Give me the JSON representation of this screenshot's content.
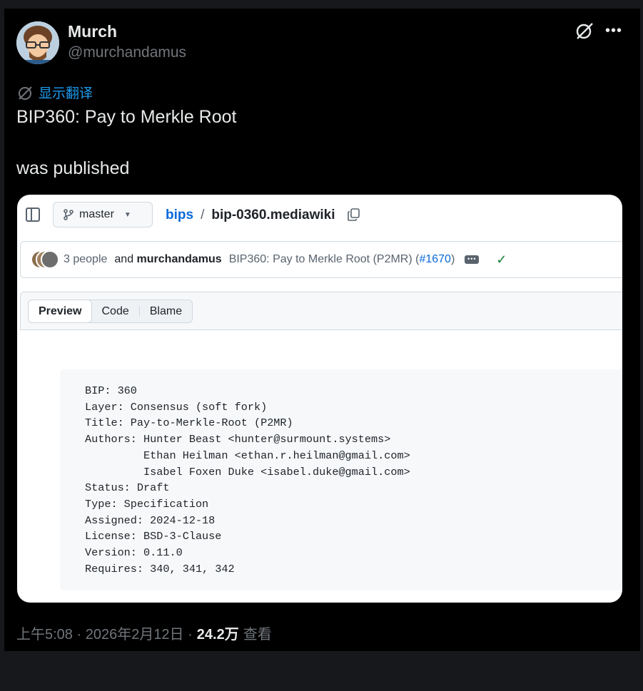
{
  "author": {
    "name": "Murch",
    "handle": "@murchandamus"
  },
  "translate_label": "显示翻译",
  "tweet": {
    "line1": "BIP360: Pay to Merkle Root",
    "line2": "was published"
  },
  "icons": {
    "grok": "grok-icon",
    "more": "more-icon",
    "translate": "translate-icon"
  },
  "github": {
    "branch": "master",
    "path_repo": "bips",
    "path_sep": "/",
    "path_file": "bip-0360.mediawiki",
    "commit": {
      "people": "3 people",
      "and": "and",
      "author": "murchandamus",
      "message": "BIP360: Pay to Merkle Root (P2MR) (",
      "pr": "#1670",
      "message_end": ")"
    },
    "tabs": [
      "Preview",
      "Code",
      "Blame"
    ],
    "code_lines": [
      "BIP: 360",
      "Layer: Consensus (soft fork)",
      "Title: Pay-to-Merkle-Root (P2MR)",
      "Authors: Hunter Beast <hunter@surmount.systems>",
      "         Ethan Heilman <ethan.r.heilman@gmail.com>",
      "         Isabel Foxen Duke <isabel.duke@gmail.com>",
      "Status: Draft",
      "Type: Specification",
      "Assigned: 2024-12-18",
      "License: BSD-3-Clause",
      "Version: 0.11.0",
      "Requires: 340, 341, 342"
    ]
  },
  "meta": {
    "time": "上午5:08 · 2026年2月12日 ·",
    "views": "24.2万",
    "views_label": "查看"
  },
  "colors": {
    "accent": "#1d9bf0",
    "link": "#0969da",
    "success": "#1a7f37"
  }
}
